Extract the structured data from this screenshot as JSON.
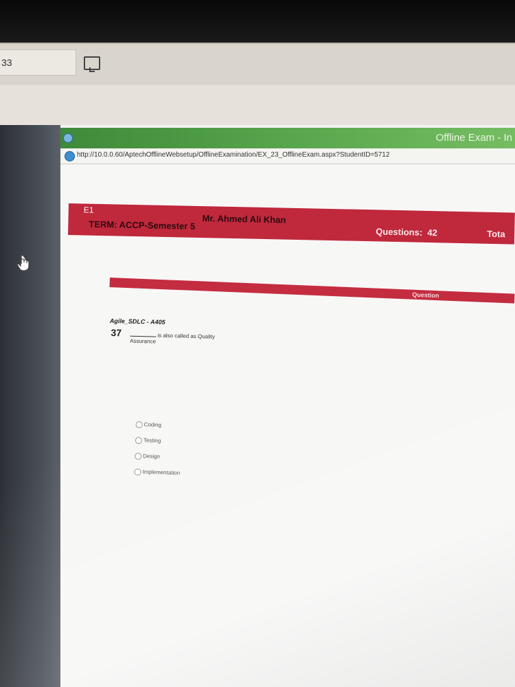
{
  "taskbar": {
    "task_label": "33"
  },
  "window": {
    "title": "Offline Exam - In",
    "url": "http://10.0.0.60/AptechOfflineWebsetup/OfflineExamination/EX_23_OfflineExam.aspx?StudentID=5712"
  },
  "exam_header": {
    "code": "E1",
    "term": "TERM: ACCP-Semester 5",
    "instructor": "Mr. Ahmed Ali Khan",
    "questions_label": "Questions:",
    "questions_count": "42",
    "total_label": "Tota"
  },
  "question_section": {
    "header_label": "Question",
    "subject": "Agile_SDLC - A405",
    "number": "37",
    "text_line1": "is also called as Quality",
    "text_line2": "Assurance",
    "options": [
      {
        "label": "Coding"
      },
      {
        "label": "Testing"
      },
      {
        "label": "Design"
      },
      {
        "label": "Implementation"
      }
    ]
  },
  "colors": {
    "header_red": "#c0283c",
    "titlebar_green": "#4f9a45"
  }
}
